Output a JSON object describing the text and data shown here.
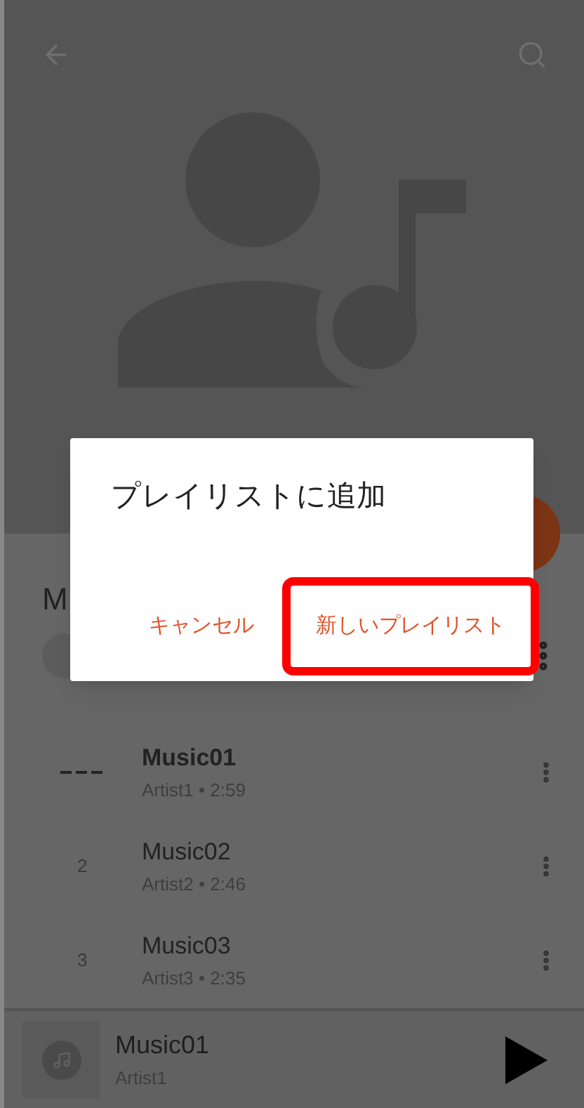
{
  "album": {
    "title": "M"
  },
  "tracks": [
    {
      "title": "Music01",
      "subtitle": "Artist1 • 2:59",
      "playing": true
    },
    {
      "number": "2",
      "title": "Music02",
      "subtitle": "Artist2 • 2:46",
      "playing": false
    },
    {
      "number": "3",
      "title": "Music03",
      "subtitle": "Artist3 • 2:35",
      "playing": false
    }
  ],
  "now_playing": {
    "title": "Music01",
    "artist": "Artist1"
  },
  "dialog": {
    "title": "プレイリストに追加",
    "buttons": [
      {
        "label": "キャンセル",
        "highlighted": false
      },
      {
        "label": "新しいプレイリスト",
        "highlighted": true
      }
    ]
  }
}
